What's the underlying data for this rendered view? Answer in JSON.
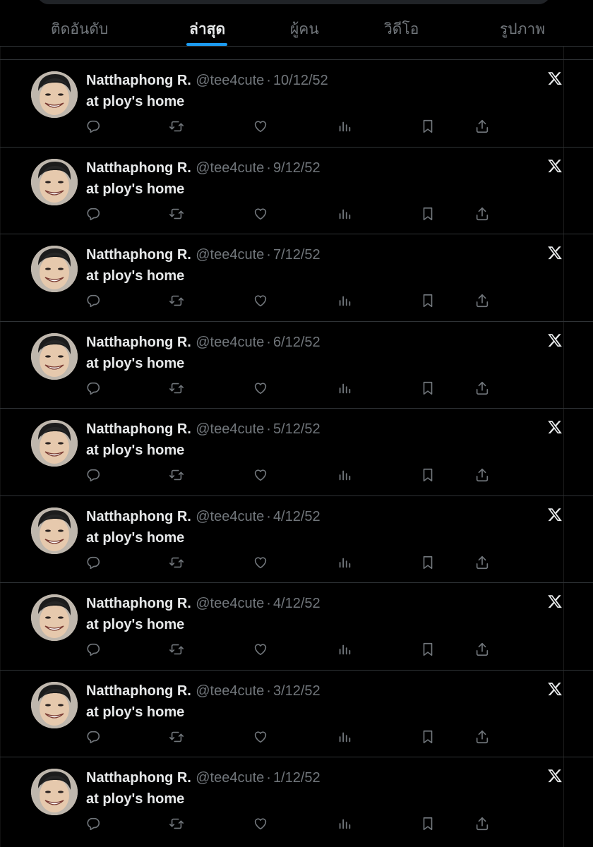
{
  "tabs": [
    {
      "label": "ติดอันดับ",
      "active": false
    },
    {
      "label": "ล่าสุด",
      "active": true
    },
    {
      "label": "ผู้คน",
      "active": false
    },
    {
      "label": "วิดีโอ",
      "active": false
    },
    {
      "label": "รูปภาพ",
      "active": false
    }
  ],
  "colors": {
    "background": "#000000",
    "text_primary": "#e7e9ea",
    "text_secondary": "#71767b",
    "accent": "#1d9bf0",
    "divider": "#2f3336"
  },
  "icons": {
    "source": "x-logo-icon",
    "actions": [
      "reply-icon",
      "retweet-icon",
      "like-icon",
      "views-icon",
      "bookmark-icon",
      "share-icon"
    ]
  },
  "tweets": [
    {
      "name": "Natthaphong R.",
      "handle": "@tee4cute",
      "separator": "·",
      "date": "10/12/52",
      "text": "at ploy's home"
    },
    {
      "name": "Natthaphong R.",
      "handle": "@tee4cute",
      "separator": "·",
      "date": "9/12/52",
      "text": "at ploy's home"
    },
    {
      "name": "Natthaphong R.",
      "handle": "@tee4cute",
      "separator": "·",
      "date": "7/12/52",
      "text": "at ploy's home"
    },
    {
      "name": "Natthaphong R.",
      "handle": "@tee4cute",
      "separator": "·",
      "date": "6/12/52",
      "text": "at ploy's home"
    },
    {
      "name": "Natthaphong R.",
      "handle": "@tee4cute",
      "separator": "·",
      "date": "5/12/52",
      "text": "at ploy's home"
    },
    {
      "name": "Natthaphong R.",
      "handle": "@tee4cute",
      "separator": "·",
      "date": "4/12/52",
      "text": "at ploy's home"
    },
    {
      "name": "Natthaphong R.",
      "handle": "@tee4cute",
      "separator": "·",
      "date": "4/12/52",
      "text": "at ploy's home"
    },
    {
      "name": "Natthaphong R.",
      "handle": "@tee4cute",
      "separator": "·",
      "date": "3/12/52",
      "text": "at ploy's home"
    },
    {
      "name": "Natthaphong R.",
      "handle": "@tee4cute",
      "separator": "·",
      "date": "1/12/52",
      "text": "at ploy's home"
    }
  ]
}
